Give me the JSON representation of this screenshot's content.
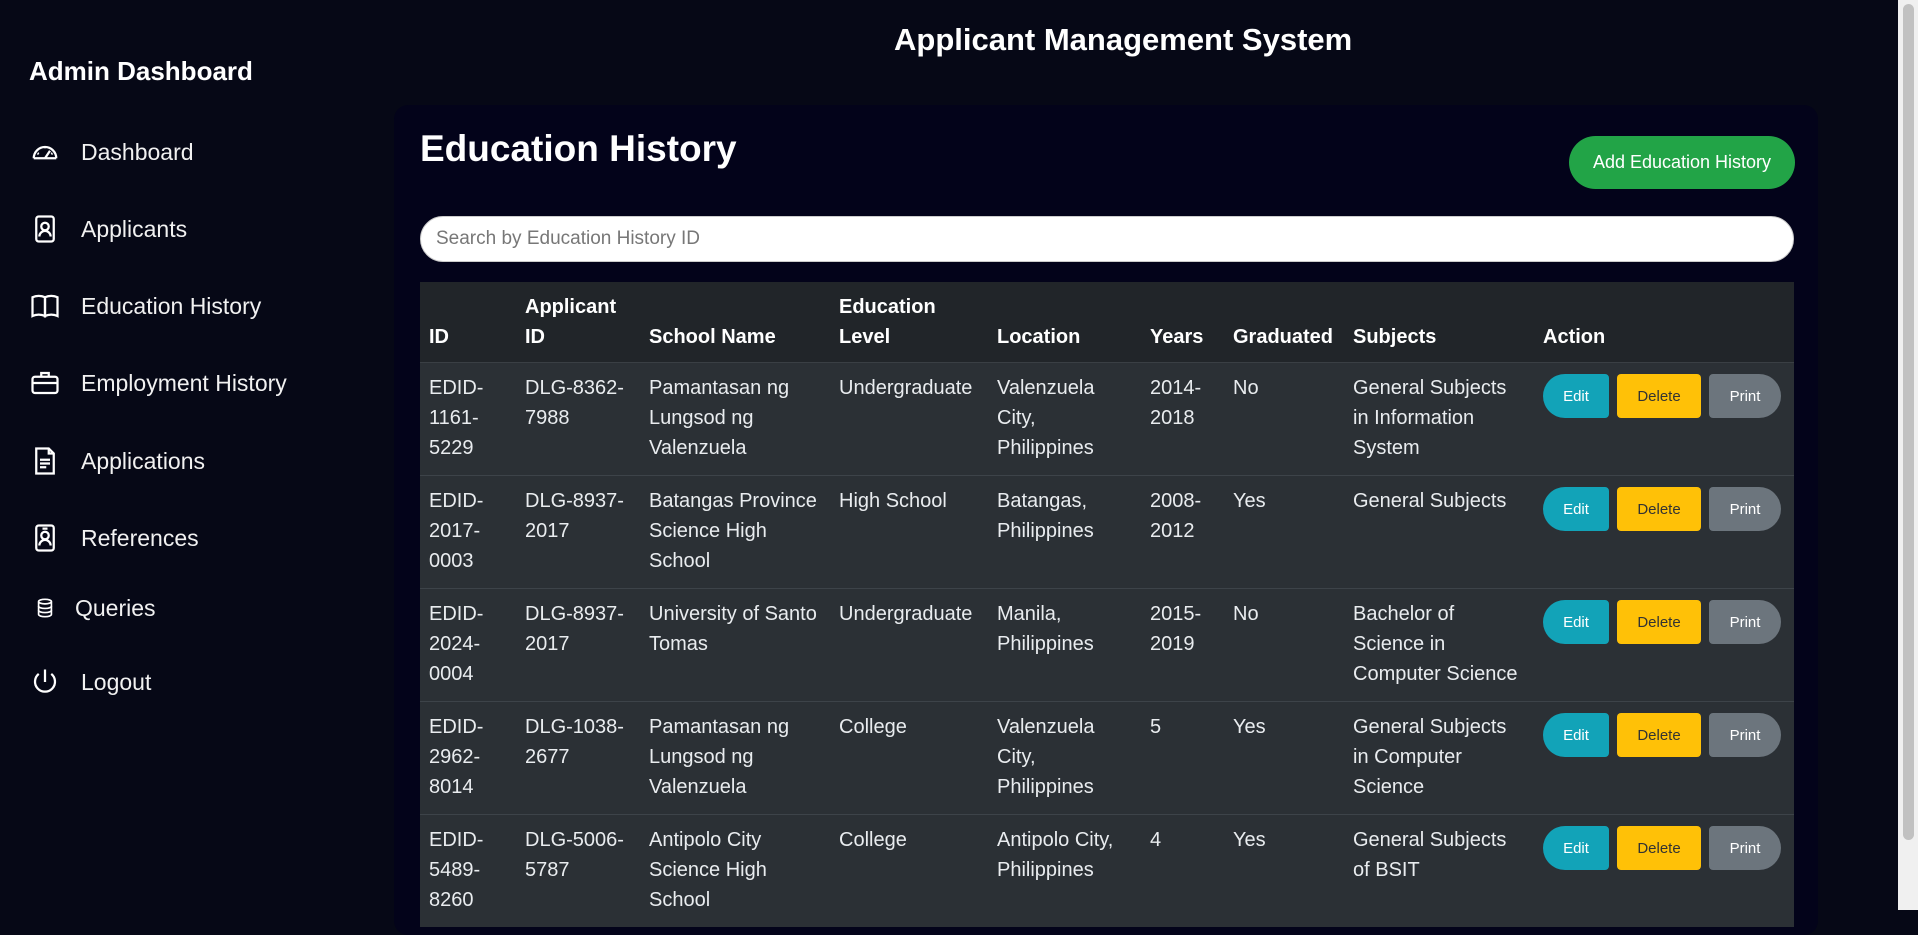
{
  "sidebar": {
    "brand": "Admin Dashboard",
    "items": [
      {
        "label": "Dashboard",
        "icon": "gauge-icon"
      },
      {
        "label": "Applicants",
        "icon": "person-badge-icon"
      },
      {
        "label": "Education History",
        "icon": "book-icon"
      },
      {
        "label": "Employment History",
        "icon": "briefcase-icon"
      },
      {
        "label": "Applications",
        "icon": "file-text-icon"
      },
      {
        "label": "References",
        "icon": "person-vcard-icon"
      },
      {
        "label": "Queries",
        "icon": "database-icon"
      },
      {
        "label": "Logout",
        "icon": "power-icon"
      }
    ]
  },
  "header": {
    "title": "Applicant Management System"
  },
  "main": {
    "title": "Education History",
    "add_button": "Add Education History",
    "search_placeholder": "Search by Education History ID"
  },
  "table": {
    "columns": [
      "ID",
      "Applicant ID",
      "School Name",
      "Education Level",
      "Location",
      "Years",
      "Graduated",
      "Subjects",
      "Action"
    ],
    "actions": {
      "edit": "Edit",
      "delete": "Delete",
      "print": "Print"
    },
    "rows": [
      {
        "id": "EDID-1161-5229",
        "applicant_id": "DLG-8362-7988",
        "school": "Pamantasan ng Lungsod ng Valenzuela",
        "level": "Undergraduate",
        "location": "Valenzuela City, Philippines",
        "years": "2014-2018",
        "graduated": "No",
        "subjects": "General Subjects in Information System"
      },
      {
        "id": "EDID-2017-0003",
        "applicant_id": "DLG-8937-2017",
        "school": "Batangas Province Science High School",
        "level": "High School",
        "location": "Batangas, Philippines",
        "years": "2008-2012",
        "graduated": "Yes",
        "subjects": "General Subjects"
      },
      {
        "id": "EDID-2024-0004",
        "applicant_id": "DLG-8937-2017",
        "school": "University of Santo Tomas",
        "level": "Undergraduate",
        "location": "Manila, Philippines",
        "years": "2015-2019",
        "graduated": "No",
        "subjects": "Bachelor of Science in Computer Science"
      },
      {
        "id": "EDID-2962-8014",
        "applicant_id": "DLG-1038-2677",
        "school": "Pamantasan ng Lungsod ng Valenzuela",
        "level": "College",
        "location": "Valenzuela City, Philippines",
        "years": "5",
        "graduated": "Yes",
        "subjects": "General Subjects in Computer Science"
      },
      {
        "id": "EDID-5489-8260",
        "applicant_id": "DLG-5006-5787",
        "school": "Antipolo City Science High School",
        "level": "College",
        "location": "Antipolo City, Philippines",
        "years": "4",
        "graduated": "Yes",
        "subjects": "General Subjects of BSIT"
      }
    ]
  }
}
